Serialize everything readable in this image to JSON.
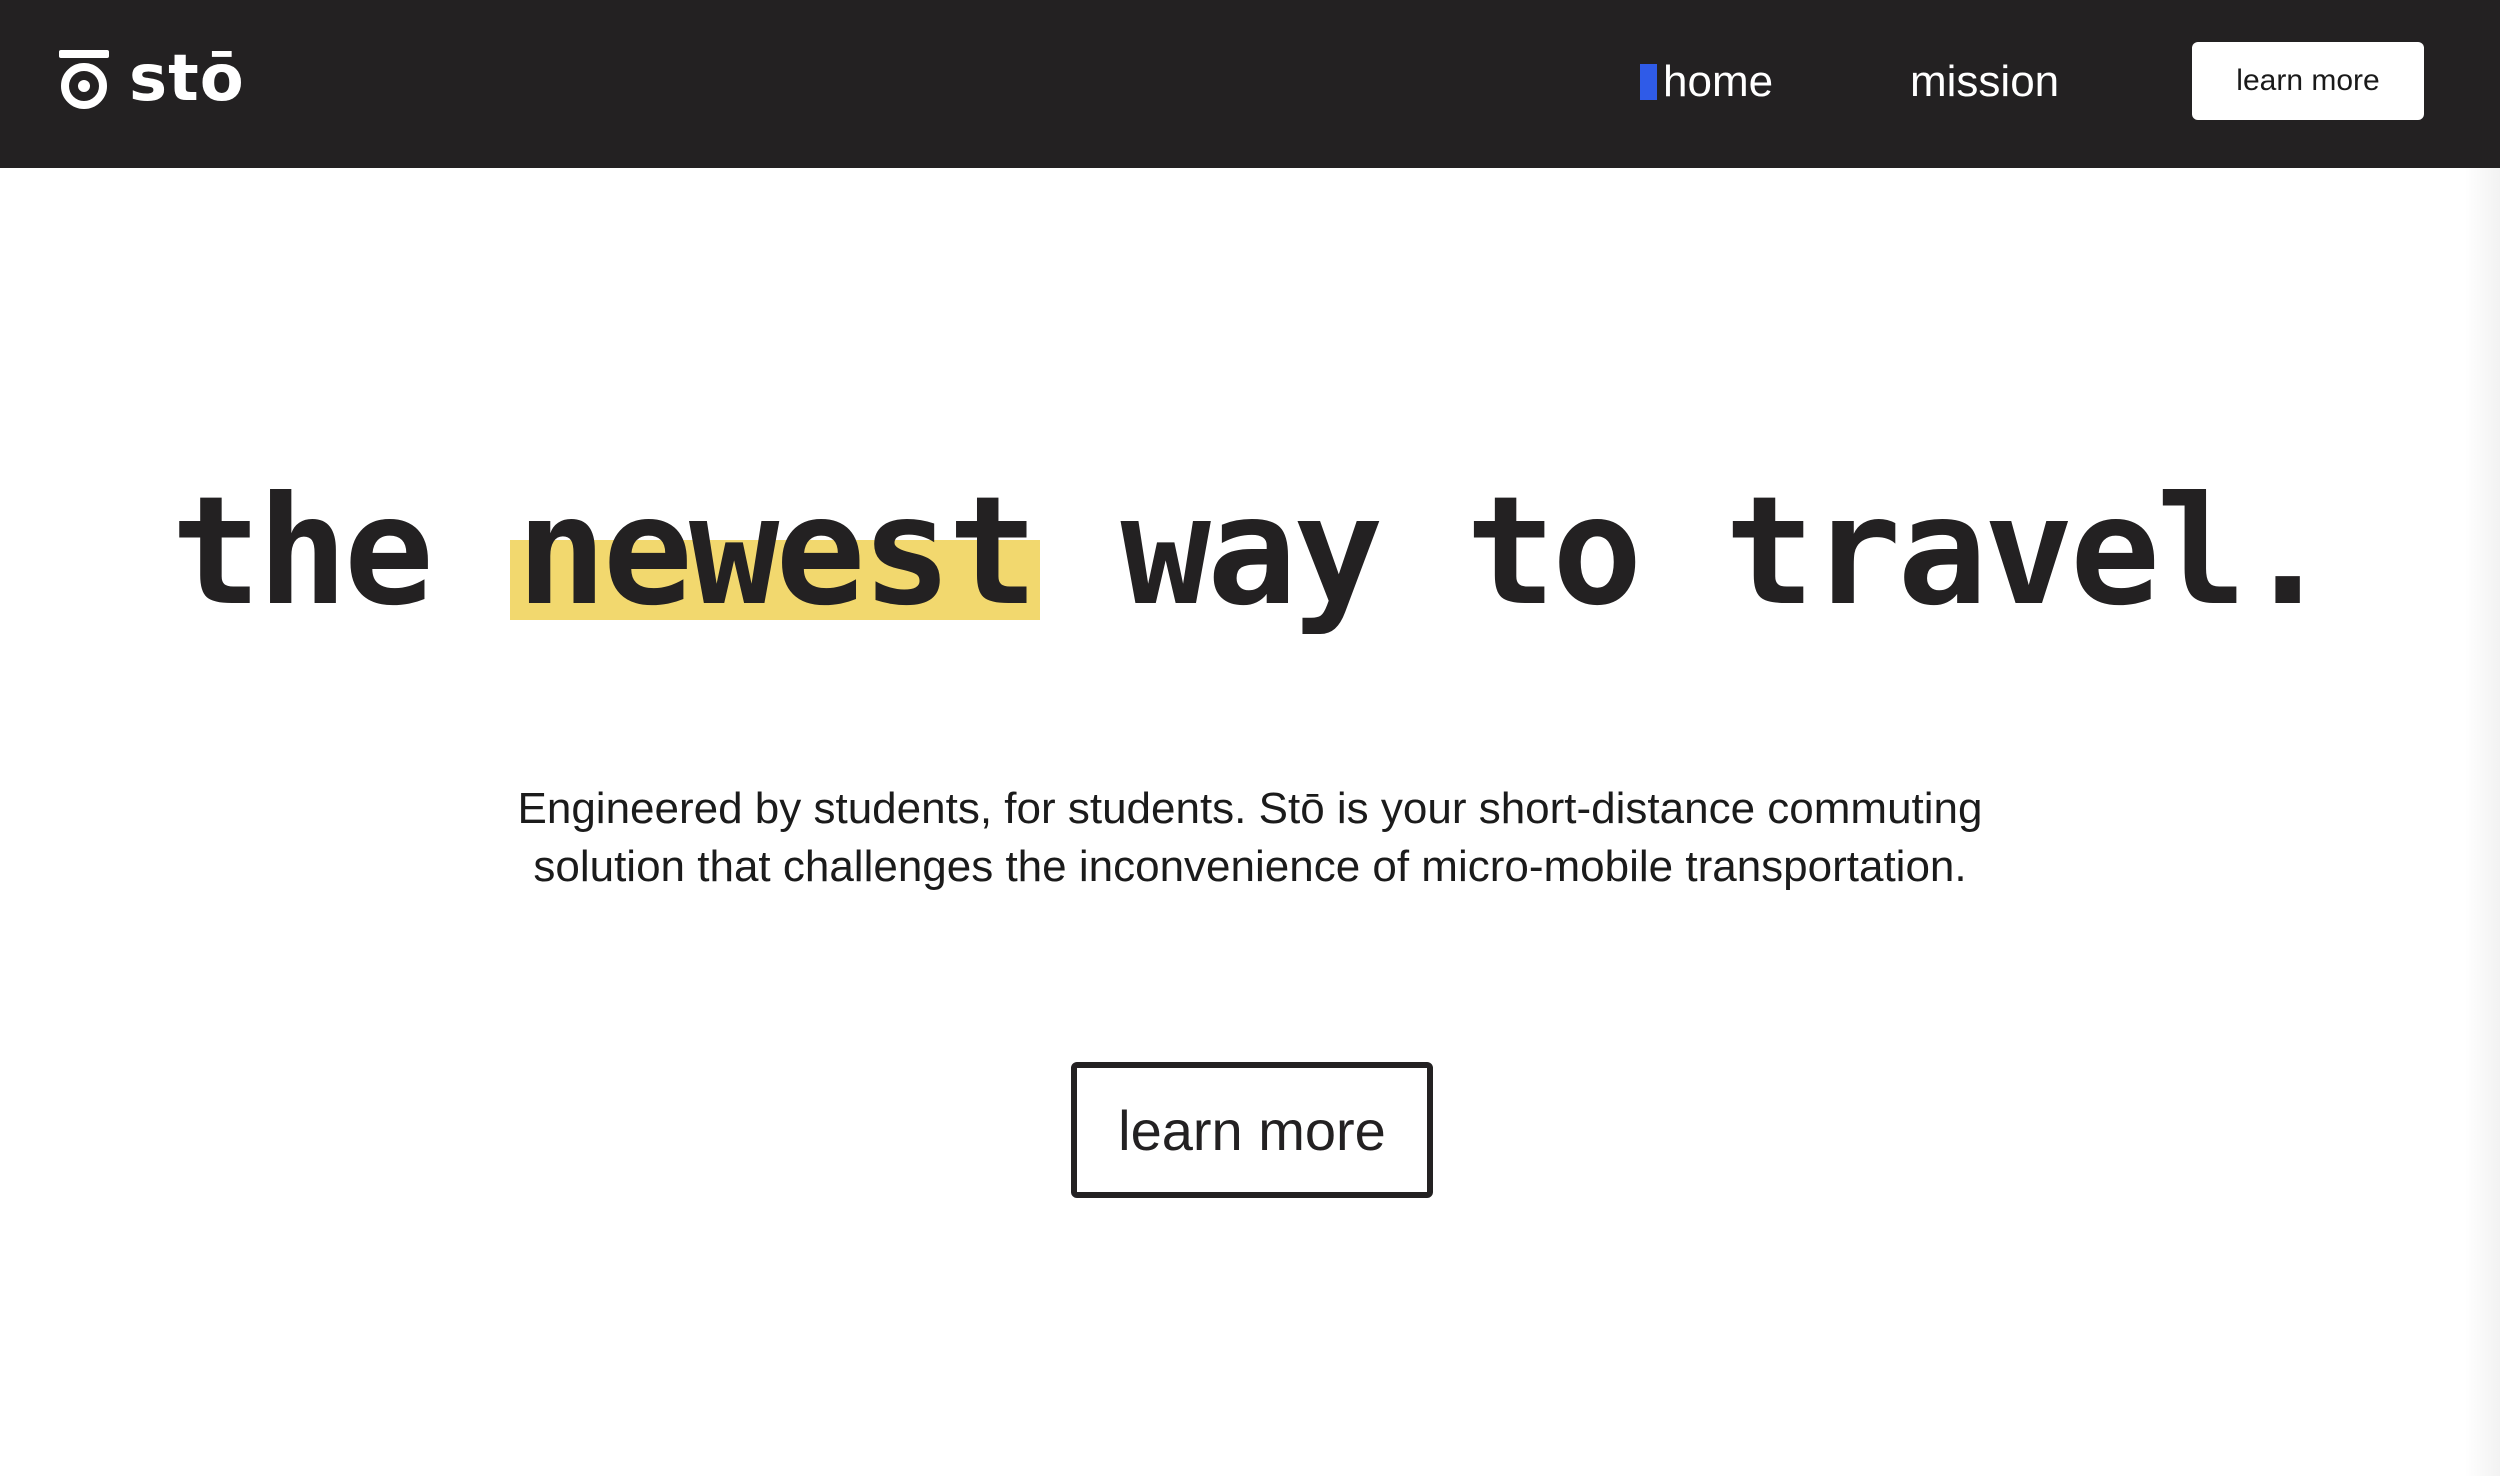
{
  "header": {
    "logo_text": "stō",
    "nav": [
      {
        "label": "home",
        "active": true
      },
      {
        "label": "mission",
        "active": false
      }
    ],
    "cta_label": "learn more"
  },
  "hero": {
    "title_before": "the",
    "title_highlight": "newest",
    "title_after": "way to travel.",
    "subtitle_line1": "Engineered by students, for students. Stō is your short-distance commuting",
    "subtitle_line2": "solution that challenges the inconvenience of micro-mobile transportation.",
    "cta_label": "learn more"
  },
  "colors": {
    "header_bg": "#232122",
    "accent_blue": "#2f5be8",
    "highlight_yellow": "#f2d86e",
    "text_dark": "#232122",
    "background": "#ffffff"
  },
  "icons": {
    "logo_mark": "sto-logo-icon",
    "nav_active_indicator": "active-nav-indicator"
  }
}
